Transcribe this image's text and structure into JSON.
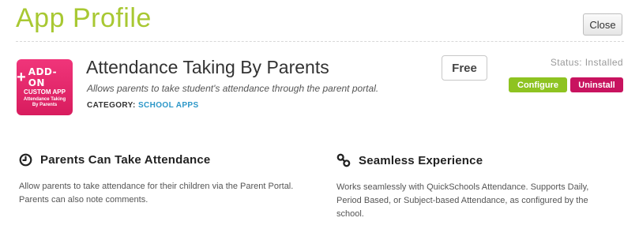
{
  "header": {
    "title": "App Profile",
    "close_label": "Close"
  },
  "app": {
    "icon": {
      "plus": "+",
      "addon": "ADD-ON",
      "custom": "CUSTOM APP",
      "name": "Attendance Taking By Parents"
    },
    "name": "Attendance Taking By Parents",
    "description": "Allows parents to take student's attendance through the parent portal.",
    "category_label": "CATEGORY:",
    "category_value": "SCHOOL APPS",
    "price": "Free",
    "status_label": "Status:",
    "status_value": "Installed",
    "configure_label": "Configure",
    "uninstall_label": "Uninstall"
  },
  "features": [
    {
      "icon": "clock-icon",
      "title": "Parents Can Take Attendance",
      "text": "Allow parents to take attendance for their children via the Parent Portal. Parents can also note comments."
    },
    {
      "icon": "link-icon",
      "title": "Seamless Experience",
      "text": "Works seamlessly with QuickSchools Attendance. Supports Daily, Period Based, or Subject-based Attendance, as configured by the school."
    }
  ],
  "colors": {
    "title": "#a8c832",
    "configure": "#8ec321",
    "uninstall": "#c8135f",
    "icon_bg": "#e0246a",
    "category_link": "#2c97c8"
  }
}
